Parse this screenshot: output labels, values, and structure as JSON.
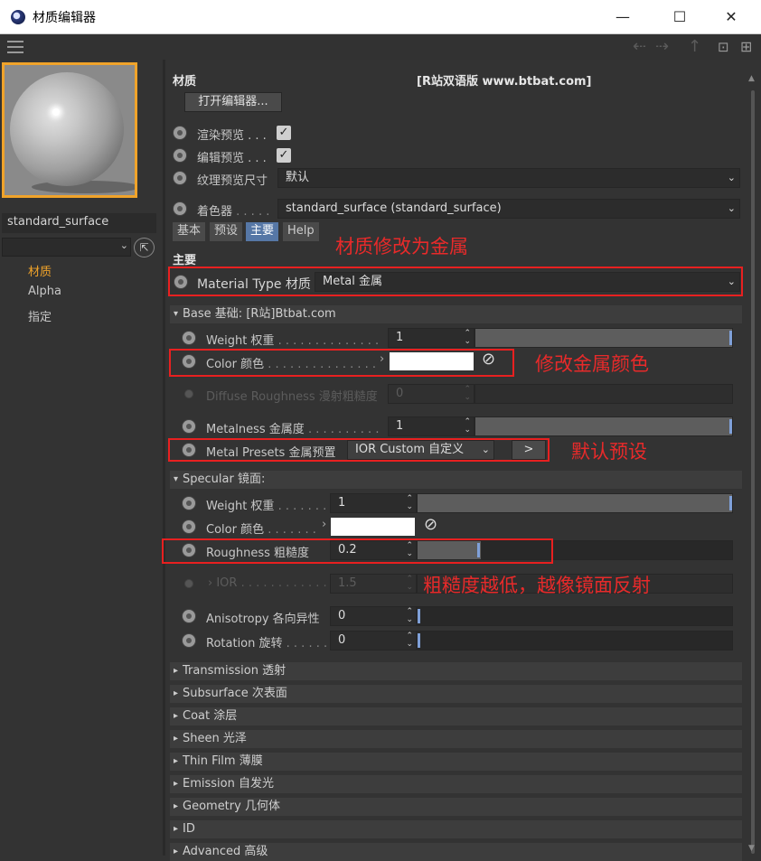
{
  "window": {
    "title": "材质编辑器",
    "minimize": "—",
    "maximize": "☐",
    "close": "✕"
  },
  "toolbar": {
    "menu_icon": "hamburger-menu-icon",
    "back": "⇠",
    "forward": "⇢",
    "up": "↑",
    "lock": "🔒",
    "newwin": "⊞"
  },
  "left": {
    "material_name": "standard_surface",
    "pick": "⇱",
    "items": [
      {
        "label": "材质",
        "active": true
      },
      {
        "label": "Alpha",
        "active": false
      },
      {
        "label": "指定",
        "active": false
      }
    ]
  },
  "header": {
    "title": "材质",
    "watermark": "[R站双语版 www.btbat.com]",
    "open_editor": "打开编辑器..."
  },
  "preview_opts": {
    "render_preview": "渲染预览 . . .",
    "edit_preview": "编辑预览 . . .",
    "texture_size": "纹理预览尺寸",
    "texture_size_value": "默认",
    "shader_label": "着色器",
    "shader_dots": " . . . . .",
    "shader_value": "standard_surface (standard_surface)"
  },
  "tabs": [
    "基本",
    "预设",
    "主要",
    "Help"
  ],
  "main_heading": "主要",
  "material_type": {
    "label": "Material Type 材质",
    "value": "Metal 金属"
  },
  "base": {
    "title": "Base 基础:",
    "subtitle": "[R站]Btbat.com",
    "weight_label": "Weight 权重",
    "weight_dots": " . . . . . . . . . . . . . .",
    "weight_value": "1",
    "color_label": "Color 颜色",
    "color_dots": " . . . . . . . . . . . . . . .",
    "diffuse_label": "Diffuse Roughness 漫射粗糙度",
    "diffuse_value": "0",
    "metalness_label": "Metalness 金属度",
    "metalness_dots": " . . . . . . . . . .",
    "metalness_value": "1",
    "presets_label": "Metal Presets 金属预置",
    "presets_value": "IOR Custom 自定义",
    "presets_btn": ">"
  },
  "specular": {
    "title": "Specular 镜面:",
    "weight_label": "Weight 权重",
    "weight_dots": " . . . . . . .",
    "weight_value": "1",
    "color_label": "Color 颜色",
    "color_dots": " . . . . . . .",
    "roughness_label": "Roughness 粗糙度",
    "roughness_value": "0.2",
    "ior_label": "IOR",
    "ior_dots": " . . . . . . . . . . . .",
    "ior_value": "1.5",
    "aniso_label": "Anisotropy 各向异性",
    "aniso_value": "0",
    "rotation_label": "Rotation 旋转",
    "rotation_dots": " . . . . . .",
    "rotation_value": "0"
  },
  "sections": [
    "Transmission 透射",
    "Subsurface 次表面",
    "Coat 涂层",
    "Sheen 光泽",
    "Thin Film 薄膜",
    "Emission 自发光",
    "Geometry 几何体",
    "ID",
    "Advanced 高级"
  ],
  "annotations": {
    "a1": "材质修改为金属",
    "a2": "修改金属颜色",
    "a3": "默认预设",
    "a4": "粗糙度越低，越像镜面反射"
  },
  "colors": {
    "accent": "#f0a32a",
    "tab_active": "#5677a6",
    "annotation": "#e82020",
    "slider_knob": "#7fa0d8"
  },
  "values": {
    "base_weight": 1,
    "metalness": 1,
    "spec_weight": 1,
    "roughness": 0.2,
    "anisotropy": 0,
    "rotation": 0
  }
}
